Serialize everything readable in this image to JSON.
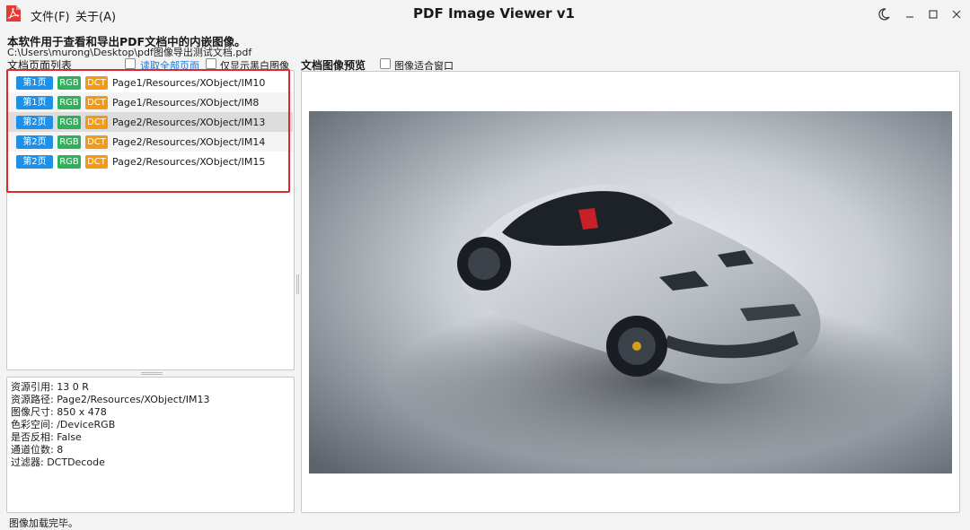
{
  "window": {
    "title": "PDF Image Viewer v1",
    "menu": {
      "file": "文件(F)",
      "about": "关于(A)"
    },
    "controls": {
      "theme_icon": "moon-icon",
      "minimize_icon": "minimize-icon",
      "maximize_icon": "maximize-icon",
      "close_icon": "close-icon"
    }
  },
  "header": {
    "description": "本软件用于查看和导出PDF文档中的内嵌图像。",
    "file_path": "C:\\Users\\murong\\Desktop\\pdf图像导出测试文档.pdf"
  },
  "list_section": {
    "label": "文档页面列表",
    "read_all_label": "读取全部页面",
    "read_all_checked": false,
    "bw_only_label": "仅显示黑白图像",
    "bw_only_checked": false,
    "rows": [
      {
        "page": "第1页",
        "colorspace": "RGB",
        "filter": "DCT",
        "resource": "Page1/Resources/XObject/IM10"
      },
      {
        "page": "第1页",
        "colorspace": "RGB",
        "filter": "DCT",
        "resource": "Page1/Resources/XObject/IM8"
      },
      {
        "page": "第2页",
        "colorspace": "RGB",
        "filter": "DCT",
        "resource": "Page2/Resources/XObject/IM13"
      },
      {
        "page": "第2页",
        "colorspace": "RGB",
        "filter": "DCT",
        "resource": "Page2/Resources/XObject/IM14"
      },
      {
        "page": "第2页",
        "colorspace": "RGB",
        "filter": "DCT",
        "resource": "Page2/Resources/XObject/IM15"
      }
    ],
    "selected_index": 2
  },
  "info": {
    "lines": [
      "资源引用:  13 0 R",
      "资源路径:  Page2/Resources/XObject/IM13",
      "图像尺寸:  850 x 478",
      "色彩空间:  /DeviceRGB",
      "是否反相:  False",
      "通道位数:  8",
      "过滤器:  DCTDecode"
    ]
  },
  "preview": {
    "label": "文档图像预览",
    "fit_window_label": "图像适合窗口",
    "fit_window_checked": false
  },
  "status": "图像加载完毕。",
  "colors": {
    "page_badge": "#1e90e8",
    "rgb_badge": "#2fb05b",
    "dct_badge": "#f29a14",
    "highlight": "#e0262e",
    "link": "#1e73d8"
  }
}
